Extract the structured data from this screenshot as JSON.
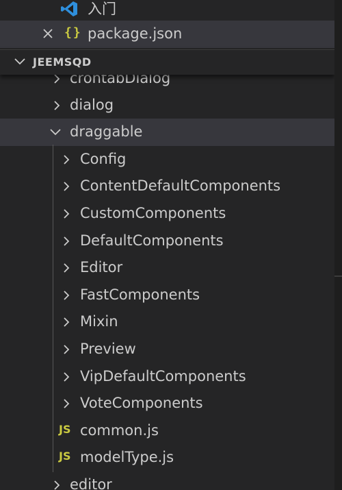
{
  "open_editors": {
    "items": [
      {
        "label": "入门",
        "icon": "vscode-icon"
      },
      {
        "label": "package.json",
        "icon": "json-braces-icon",
        "close_icon": "close-icon"
      }
    ]
  },
  "explorer": {
    "section_title": "JEEMSQD",
    "tree": [
      {
        "label": "crontabDialog",
        "type": "folder",
        "expanded": false
      },
      {
        "label": "dialog",
        "type": "folder",
        "expanded": false
      },
      {
        "label": "draggable",
        "type": "folder",
        "expanded": true
      },
      {
        "label": "Config",
        "type": "folder",
        "expanded": false
      },
      {
        "label": "ContentDefaultComponents",
        "type": "folder",
        "expanded": false
      },
      {
        "label": "CustomComponents",
        "type": "folder",
        "expanded": false
      },
      {
        "label": "DefaultComponents",
        "type": "folder",
        "expanded": false
      },
      {
        "label": "Editor",
        "type": "folder",
        "expanded": false
      },
      {
        "label": "FastComponents",
        "type": "folder",
        "expanded": false
      },
      {
        "label": "Mixin",
        "type": "folder",
        "expanded": false
      },
      {
        "label": "Preview",
        "type": "folder",
        "expanded": false
      },
      {
        "label": "VipDefaultComponents",
        "type": "folder",
        "expanded": false
      },
      {
        "label": "VoteComponents",
        "type": "folder",
        "expanded": false
      },
      {
        "label": "common.js",
        "type": "file",
        "icon_text": "JS"
      },
      {
        "label": "modelType.js",
        "type": "file",
        "icon_text": "JS"
      },
      {
        "label": "editor",
        "type": "folder",
        "expanded": false
      }
    ]
  },
  "colors": {
    "background": "#252526",
    "selection": "#37373d",
    "text": "#cccccc",
    "js_icon": "#cbcb41",
    "vscode_blue": "#2f8fdc"
  }
}
